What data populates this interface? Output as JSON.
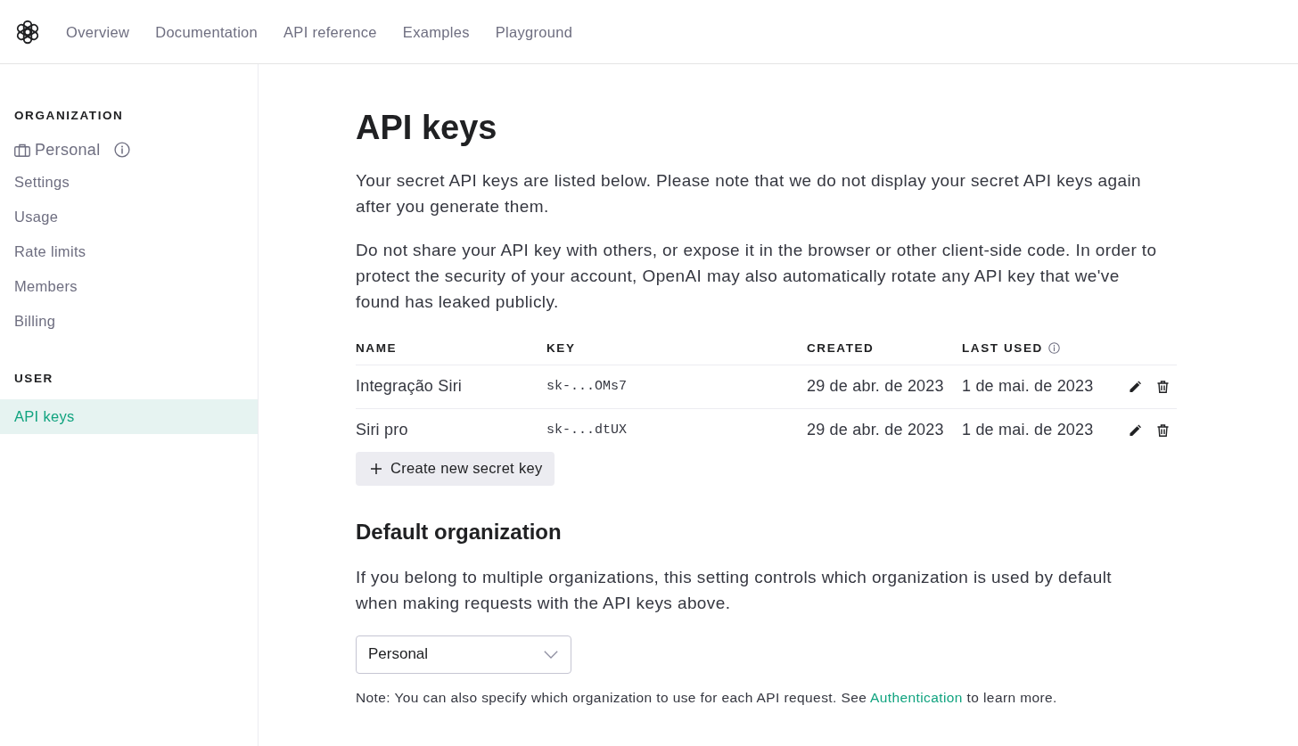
{
  "nav": {
    "items": [
      {
        "label": "Overview"
      },
      {
        "label": "Documentation"
      },
      {
        "label": "API reference"
      },
      {
        "label": "Examples"
      },
      {
        "label": "Playground"
      }
    ]
  },
  "sidebar": {
    "sections": [
      {
        "heading": "ORGANIZATION",
        "items": [
          {
            "kind": "org",
            "label": "Personal",
            "selected": false
          },
          {
            "kind": "link",
            "label": "Settings",
            "selected": false
          },
          {
            "kind": "link",
            "label": "Usage",
            "selected": false
          },
          {
            "kind": "link",
            "label": "Rate limits",
            "selected": false
          },
          {
            "kind": "link",
            "label": "Members",
            "selected": false
          },
          {
            "kind": "link",
            "label": "Billing",
            "selected": false
          }
        ]
      },
      {
        "heading": "USER",
        "items": [
          {
            "kind": "link",
            "label": "API keys",
            "selected": true
          }
        ]
      }
    ]
  },
  "page": {
    "title": "API keys",
    "paragraphs": [
      "Your secret API keys are listed below. Please note that we do not display your secret API keys again after you generate them.",
      "Do not share your API key with others, or expose it in the browser or other client-side code. In order to protect the security of your account, OpenAI may also automatically rotate any API key that we've found has leaked publicly."
    ]
  },
  "table": {
    "columns": [
      {
        "label": "NAME",
        "info": false
      },
      {
        "label": "KEY",
        "info": false
      },
      {
        "label": "CREATED",
        "info": false
      },
      {
        "label": "LAST USED",
        "info": true
      }
    ],
    "rows": [
      {
        "name": "Integração Siri",
        "key": "sk-...OMs7",
        "created": "29 de abr. de 2023",
        "last_used": "1 de mai. de 2023"
      },
      {
        "name": "Siri pro",
        "key": "sk-...dtUX",
        "created": "29 de abr. de 2023",
        "last_used": "1 de mai. de 2023"
      }
    ]
  },
  "create_button": {
    "label": "Create new secret key"
  },
  "default_organization": {
    "heading": "Default organization",
    "description": "If you belong to multiple organizations, this setting controls which organization is used by default when making requests with the API keys above.",
    "select": {
      "value": "Personal"
    },
    "note": {
      "before": "Note: You can also specify which organization to use for each API request. See ",
      "link": "Authentication",
      "after": " to learn more."
    }
  }
}
